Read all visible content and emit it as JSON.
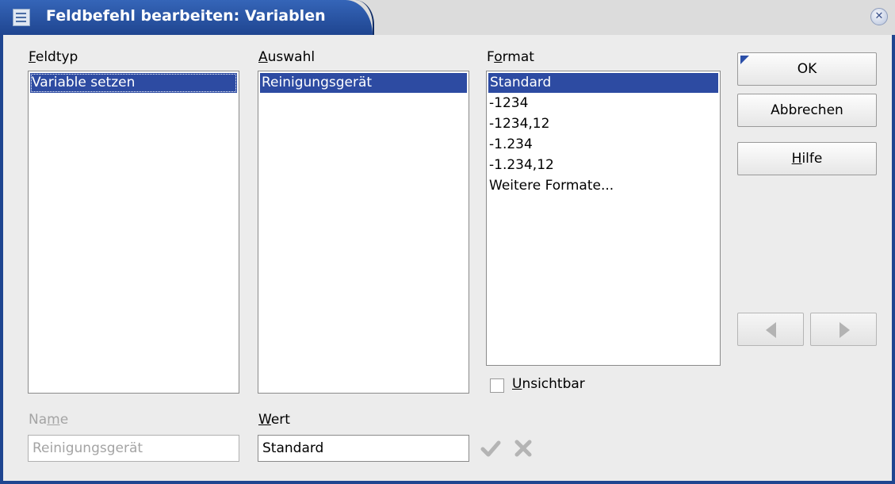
{
  "window": {
    "title": "Feldbefehl bearbeiten: Variablen"
  },
  "feldtyp": {
    "label_mnemonic": "F",
    "label_rest": "eldtyp",
    "items": [
      "Variable setzen"
    ]
  },
  "auswahl": {
    "label_mnemonic": "A",
    "label_rest": "uswahl",
    "items": [
      "Reinigungsgerät"
    ]
  },
  "format": {
    "label_pre": "F",
    "label_mnemonic": "o",
    "label_rest": "rmat",
    "items": [
      "Standard",
      "-1234",
      "-1234,12",
      "-1.234",
      "-1.234,12",
      "Weitere Formate..."
    ]
  },
  "buttons": {
    "ok": "OK",
    "cancel": "Abbrechen",
    "help_mnemonic": "H",
    "help_rest": "ilfe"
  },
  "unsichtbar": {
    "mnemonic": "U",
    "rest": "nsichtbar",
    "checked": false
  },
  "name": {
    "pre": "Na",
    "mnemonic": "m",
    "rest": "e",
    "value": "Reinigungsgerät"
  },
  "wert": {
    "mnemonic": "W",
    "rest": "ert",
    "value": "Standard"
  },
  "icons": {
    "apply": "checkmark-icon",
    "delete": "x-icon",
    "prev": "arrow-left-icon",
    "next": "arrow-right-icon"
  },
  "colors": {
    "titlebar": "#1f4590",
    "selection": "#2d4ba2"
  }
}
